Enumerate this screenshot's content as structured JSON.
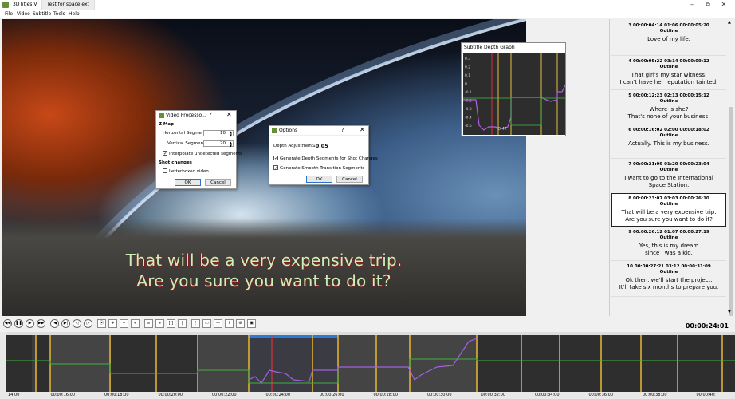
{
  "app": {
    "title": "3DTitles V",
    "tab": "Test for space.ext",
    "min_icon": "minimize-icon",
    "max_icon": "maximize-icon",
    "close_icon": "close-icon"
  },
  "menu": [
    "File",
    "Video",
    "Subtitle",
    "Tools",
    "Help"
  ],
  "video": {
    "subtitle_lines": [
      "That will be a very expensive trip.",
      "Are you sure you want to do it?"
    ]
  },
  "video_processor": {
    "title": "Video Processo...",
    "help": "?",
    "section_zmap": "Z Map",
    "h_label": "Horizontal Segments:",
    "h_value": "10",
    "v_label": "Vertical Segments:",
    "v_value": "20",
    "interp_label": "Interpolate undetected segments",
    "section_shot": "Shot changes",
    "letterboxed_label": "Letterboxed video",
    "ok": "OK",
    "cancel": "Cancel"
  },
  "options": {
    "title": "Options",
    "help": "?",
    "depth_label": "Depth Adjustment:",
    "depth_value": "-0.05",
    "gen_shot_label": "Generate Depth Segments for Shot Changes",
    "gen_smooth_label": "Generate Smooth Transition Segments",
    "ok": "OK",
    "cancel": "Cancel"
  },
  "depth_graph": {
    "title": "Subtitle Depth Graph",
    "yticks": [
      "0.3",
      "0.2",
      "0.1",
      "0",
      "-0.1",
      "-0.2",
      "-0.3",
      "-0.4",
      "-0.5"
    ],
    "marker": "-0.47"
  },
  "subtitles": [
    {
      "hdr": "3   00:00:04:14   01:06   00:00:05:20",
      "cls": "Outline",
      "lines": [
        "Love of my life."
      ]
    },
    {
      "hdr": "4   00:00:05:22   03:14   00:00:09:12",
      "cls": "Outline",
      "lines": [
        "That girl's my star witness.",
        "I can't have her reputation tainted."
      ]
    },
    {
      "hdr": "5   00:00:12:23   02:13   00:00:15:12",
      "cls": "Outline",
      "lines": [
        "Where is she?",
        "That's none of your business."
      ]
    },
    {
      "hdr": "6   00:00:16:02   02:00   00:00:18:02",
      "cls": "Outline",
      "lines": [
        "Actually.  This is my business."
      ]
    },
    {
      "hdr": "7   00:00:21:09   01:20   00:00:23:04",
      "cls": "Outline",
      "lines": [
        "I want to go to the International",
        "Space Station."
      ]
    },
    {
      "hdr": "8   00:00:23:07   03:03   00:00:26:10",
      "cls": "Outline",
      "lines": [
        "That will be a very expensive trip.",
        "Are you sure you want to do it?"
      ]
    },
    {
      "hdr": "9   00:00:26:12   01:07   00:00:27:19",
      "cls": "Outline",
      "lines": [
        "Yes, this is my dream",
        "since I was a kid."
      ]
    },
    {
      "hdr": "10   00:00:27:21   03:12   00:00:31:09",
      "cls": "Outline",
      "lines": [
        "Ok then, we'll start the project.",
        "It'll take six months to prepare you."
      ]
    }
  ],
  "controls": {
    "timecode": "00:00:24:01",
    "buttons": [
      "rewind-icon",
      "pause-icon",
      "play-icon",
      "fast-forward-icon",
      "prev-frame-icon",
      "next-frame-icon",
      "prev-subtitle-icon",
      "next-subtitle-icon",
      "mark-in-icon",
      "zoom-in-icon",
      "zoom-out-icon",
      "align-left-icon",
      "align-center-icon",
      "align-right-icon",
      "bracket-icon",
      "bar-icon",
      "split-icon",
      "merge-icon",
      "line-icon",
      "snap-icon",
      "settings-icon",
      "monitor-icon"
    ]
  },
  "timeline": {
    "labels": [
      "14:00",
      "00:00:16:00",
      "00:00:18:00",
      "00:00:20:00",
      "00:00:22:00",
      "00:00:24:00",
      "00:00:26:00",
      "00:00:28:00",
      "00:00:30:00",
      "00:00:32:00",
      "00:00:34:00",
      "00:00:36:00",
      "00:00:38:00",
      "00:00:40:"
    ]
  }
}
